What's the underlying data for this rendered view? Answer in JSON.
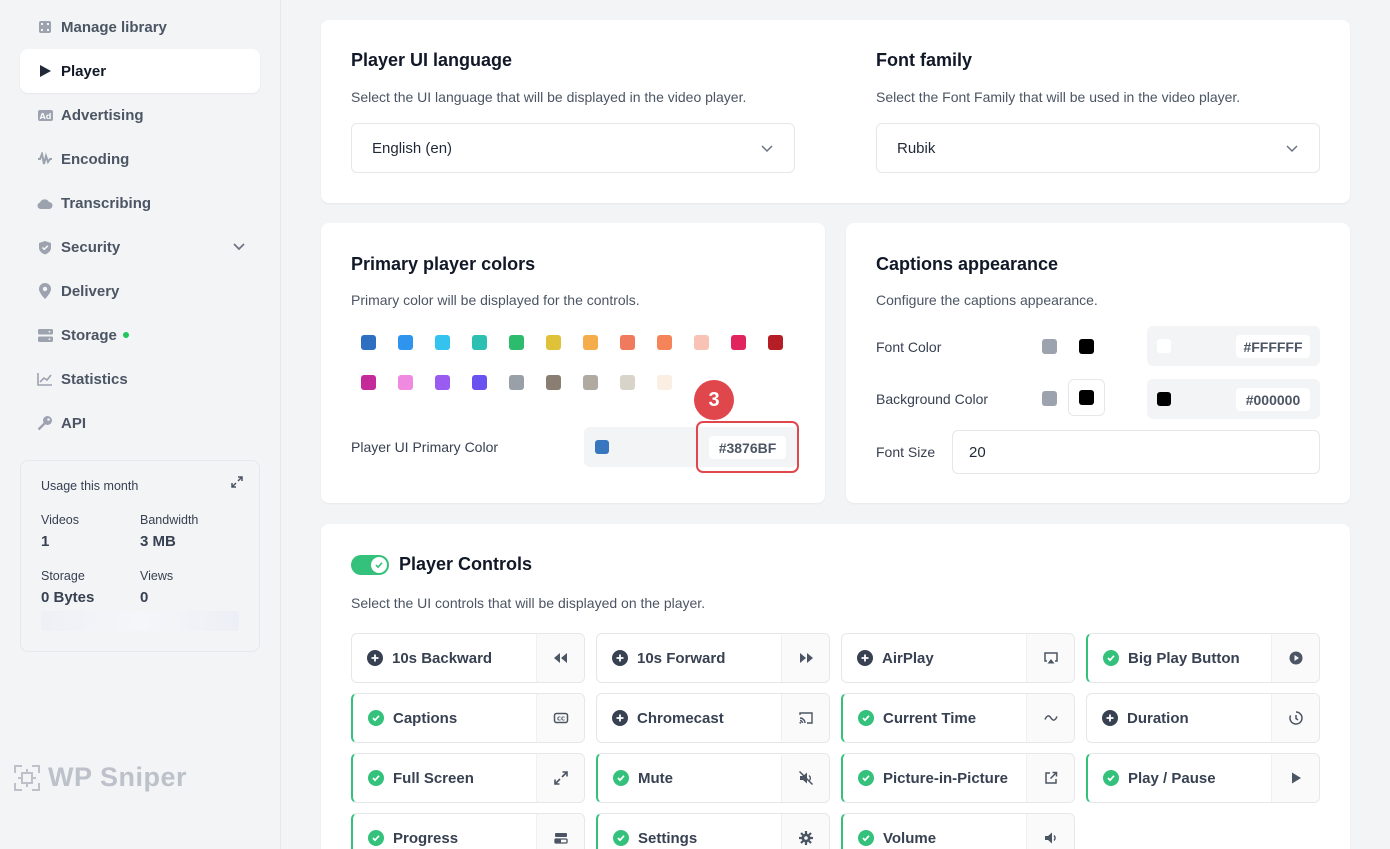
{
  "sidebar": {
    "items": [
      {
        "label": "Manage library",
        "icon": "film-icon"
      },
      {
        "label": "Player",
        "icon": "play-icon"
      },
      {
        "label": "Advertising",
        "icon": "ad-icon"
      },
      {
        "label": "Encoding",
        "icon": "waveform-icon"
      },
      {
        "label": "Transcribing",
        "icon": "cloud-icon"
      },
      {
        "label": "Security",
        "icon": "shield-icon"
      },
      {
        "label": "Delivery",
        "icon": "location-pin-icon"
      },
      {
        "label": "Storage",
        "icon": "storage-icon"
      },
      {
        "label": "Statistics",
        "icon": "chart-icon"
      },
      {
        "label": "API",
        "icon": "key-icon"
      }
    ],
    "usage": {
      "title": "Usage this month",
      "videos_label": "Videos",
      "videos_value": "1",
      "bandwidth_label": "Bandwidth",
      "bandwidth_value": "3 MB",
      "storage_label": "Storage",
      "storage_value": "0 Bytes",
      "views_label": "Views",
      "views_value": "0"
    },
    "brand": "WP Sniper"
  },
  "language": {
    "title": "Player UI language",
    "desc": "Select the UI language that will be displayed in the video player.",
    "value": "English (en)"
  },
  "font": {
    "title": "Font family",
    "desc": "Select the Font Family that will be used in the video player.",
    "value": "Rubik"
  },
  "colors": {
    "title": "Primary player colors",
    "desc": "Primary color will be displayed for the controls.",
    "swatches": [
      "#2f6fc2",
      "#2f94ee",
      "#33c3ee",
      "#2cc0b3",
      "#2dbb6e",
      "#e0c23a",
      "#f5ac4a",
      "#f07a5e",
      "#f6845a",
      "#f8c3b5",
      "#e0245e",
      "#b41e24",
      "#c52a9b",
      "#f08ae0",
      "#9a5cf0",
      "#6a52f0",
      "#9aa0a8",
      "#8a7e72",
      "#b1aaa0",
      "#d9d4ca",
      "#fbeee2"
    ],
    "primary_label": "Player UI Primary Color",
    "primary_value": "#3876BF",
    "badge": "3"
  },
  "captions": {
    "title": "Captions appearance",
    "desc": "Configure the captions appearance.",
    "font_color_label": "Font Color",
    "font_color_value": "#FFFFFF",
    "bg_color_label": "Background Color",
    "bg_color_value": "#000000",
    "font_size_label": "Font Size",
    "font_size_value": "20"
  },
  "controls": {
    "title": "Player Controls",
    "desc": "Select the UI controls that will be displayed on the player.",
    "items": [
      {
        "label": "10s Backward",
        "on": false,
        "icon": "rewind-icon"
      },
      {
        "label": "10s Forward",
        "on": false,
        "icon": "fast-forward-icon"
      },
      {
        "label": "AirPlay",
        "on": false,
        "icon": "airplay-icon"
      },
      {
        "label": "Big Play Button",
        "on": true,
        "icon": "play-circle-icon"
      },
      {
        "label": "Captions",
        "on": true,
        "icon": "cc-icon"
      },
      {
        "label": "Chromecast",
        "on": false,
        "icon": "cast-icon"
      },
      {
        "label": "Current Time",
        "on": true,
        "icon": "tilde-icon"
      },
      {
        "label": "Duration",
        "on": false,
        "icon": "timer-icon"
      },
      {
        "label": "Full Screen",
        "on": true,
        "icon": "expand-icon"
      },
      {
        "label": "Mute",
        "on": true,
        "icon": "mute-icon"
      },
      {
        "label": "Picture-in-Picture",
        "on": true,
        "icon": "external-link-icon"
      },
      {
        "label": "Play / Pause",
        "on": true,
        "icon": "play-icon"
      },
      {
        "label": "Progress",
        "on": true,
        "icon": "progress-icon"
      },
      {
        "label": "Settings",
        "on": true,
        "icon": "gear-icon"
      },
      {
        "label": "Volume",
        "on": true,
        "icon": "volume-icon"
      }
    ]
  }
}
